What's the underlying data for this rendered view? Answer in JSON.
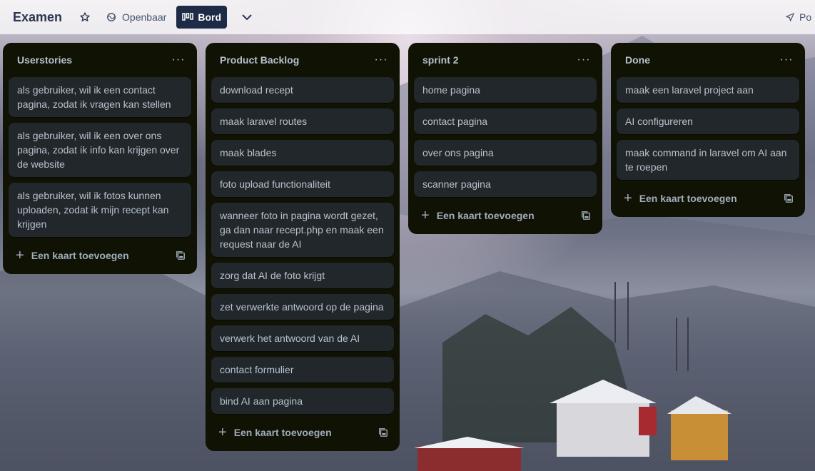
{
  "header": {
    "board_title": "Examen",
    "visibility_label": "Openbaar",
    "view_label": "Bord",
    "share_label": "Po"
  },
  "lists": [
    {
      "title": "Userstories",
      "menu": "···",
      "cards": [
        "als gebruiker, wil ik een contact pagina, zodat ik vragen kan stellen",
        "als gebruiker, wil ik een over ons pagina, zodat ik info kan krijgen over de website",
        "als gebruiker, wil ik fotos kunnen uploaden, zodat ik mijn recept kan krijgen"
      ],
      "add_label": "Een kaart toevoegen"
    },
    {
      "title": "Product Backlog",
      "menu": "···",
      "cards": [
        "download recept",
        "maak laravel routes",
        "maak blades",
        "foto upload functionaliteit",
        "wanneer foto in pagina wordt gezet, ga dan naar recept.php en maak een request naar de AI",
        "zorg dat AI de foto krijgt",
        "zet verwerkte antwoord op de pagina",
        "verwerk het antwoord van de AI",
        "contact formulier",
        "bind AI aan pagina"
      ],
      "add_label": "Een kaart toevoegen"
    },
    {
      "title": "sprint 2",
      "menu": "···",
      "cards": [
        "home pagina",
        "contact pagina",
        "over ons pagina",
        "scanner pagina"
      ],
      "add_label": "Een kaart toevoegen"
    },
    {
      "title": "Done",
      "menu": "···",
      "cards": [
        "maak een laravel project aan",
        "AI configureren",
        "maak command in laravel om AI aan te roepen"
      ],
      "add_label": "Een kaart toevoegen"
    }
  ],
  "icons": {
    "star": "star-icon",
    "globe": "globe-icon",
    "board": "board-icon",
    "chevron": "chevron-down-icon",
    "share": "send-icon",
    "plus": "plus-icon",
    "template": "card-template-icon"
  },
  "colors": {
    "list_bg": "#101204",
    "card_bg": "#22272b",
    "text": "#b6c2cf",
    "active_view": "#1d2b46"
  }
}
